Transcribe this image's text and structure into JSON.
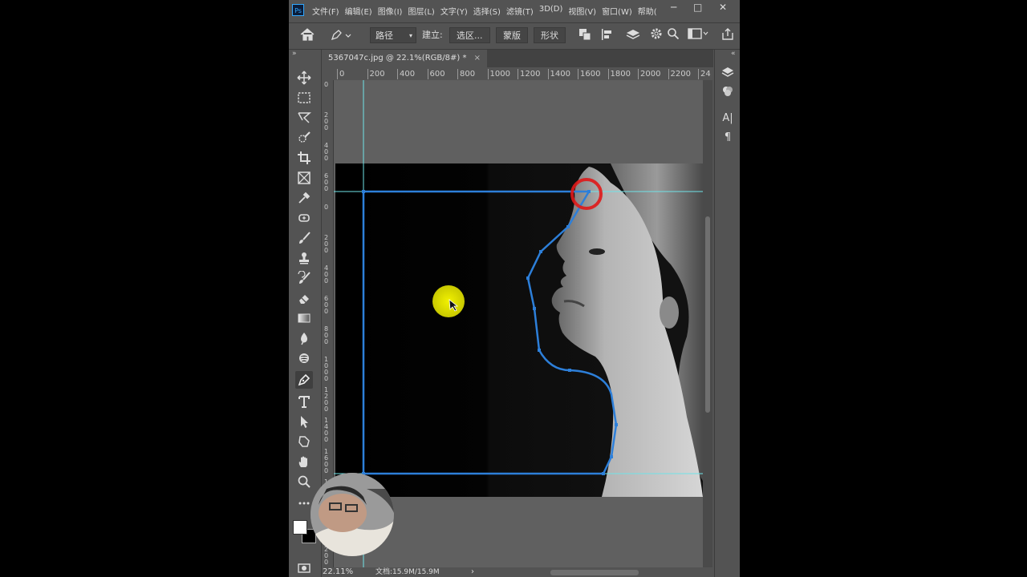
{
  "app": {
    "logo": "Ps"
  },
  "menu": [
    "文件(F)",
    "编辑(E)",
    "图像(I)",
    "图层(L)",
    "文字(Y)",
    "选择(S)",
    "滤镜(T)",
    "3D(D)",
    "视图(V)",
    "窗口(W)",
    "帮助("
  ],
  "window_controls": {
    "minimize": "─",
    "maximize": "□",
    "close": "✕"
  },
  "options": {
    "mode_value": "路径",
    "make_label": "建立:",
    "selection_button": "选区...",
    "mask_button": "蒙版",
    "shape_button": "形状"
  },
  "document": {
    "tab_title": "5367047c.jpg @ 22.1%(RGB/8#) *",
    "close": "×"
  },
  "ruler": {
    "h_ticks": [
      "0",
      "200",
      "400",
      "600",
      "800",
      "1000",
      "1200",
      "1400",
      "1600",
      "1800",
      "2000",
      "2200",
      "24"
    ],
    "v_ticks": [
      "0",
      "2\n0\n0",
      "4\n0\n0",
      "6\n0\n0",
      "0",
      "2\n0\n0",
      "4\n0\n0",
      "6\n0\n0",
      "8\n0\n0",
      "1\n0\n0\n0",
      "1\n2\n0\n0",
      "1\n4\n0\n0",
      "1\n6\n0\n0",
      "1\n8\n0\n0",
      "2\n0\n0\n0",
      "2\n2\n0\n0"
    ]
  },
  "right_panel": {
    "text_icon": "A|",
    "paragraph_icon": "¶"
  },
  "status": {
    "zoom": "22.11%",
    "doc_size": "文档:15.9M/15.9M",
    "arrow": "›"
  },
  "colors": {
    "ui_bg": "#535353",
    "path_blue": "#2d7fd9",
    "guide_cyan": "#6fe3e8",
    "highlight_red": "#e01818",
    "cursor_yellow": "#e6e600"
  }
}
